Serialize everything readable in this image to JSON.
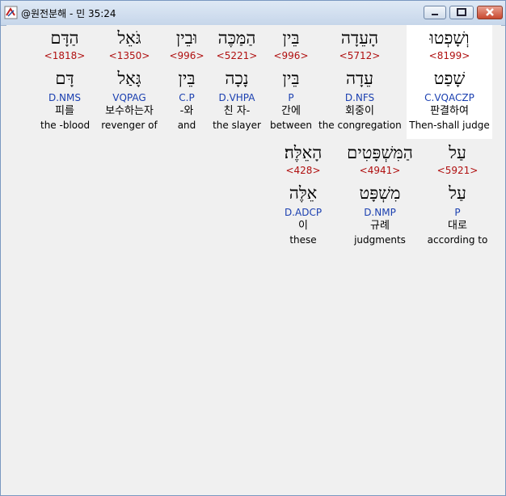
{
  "window": {
    "title": "@원전분해 - 민 35:24",
    "controls": {
      "minimize": "minimize-icon",
      "maximize": "maximize-icon",
      "close": "close-icon"
    }
  },
  "verse": {
    "line1": [
      {
        "hebrew": "הַדָּם",
        "strong": "<1818>",
        "lemma": "דָּם",
        "morph": "D.NMS",
        "korean": "피를",
        "english": "the -blood"
      },
      {
        "hebrew": "גֹּאֵל",
        "strong": "<1350>",
        "lemma": "גָּאַל",
        "morph": "VQPAG",
        "korean": "보수하는자",
        "english": "revenger of"
      },
      {
        "hebrew": "וּבֵין",
        "strong": "<996>",
        "lemma": "בֵּין",
        "morph": "C.P",
        "korean": "-와",
        "english": "and"
      },
      {
        "hebrew": "הַמַּכֶּה",
        "strong": "<5221>",
        "lemma": "נָכָה",
        "morph": "D.VHPA",
        "korean": "친 자-",
        "english": "the slayer"
      },
      {
        "hebrew": "בֵּין",
        "strong": "<996>",
        "lemma": "בֵּין",
        "morph": "P",
        "korean": "간에",
        "english": "between"
      },
      {
        "hebrew": "הָעֵדָה",
        "strong": "<5712>",
        "lemma": "עֵדָה",
        "morph": "D.NFS",
        "korean": "회중이",
        "english": "the congregation"
      },
      {
        "hebrew": "וְשָׁפְטוּ",
        "strong": "<8199>",
        "lemma": "שָׁפַט",
        "morph": "C.VQACZP",
        "korean": "판결하여",
        "english": "Then-shall judge"
      }
    ],
    "line2": [
      {
        "hebrew": "הָאֵלֶּה׃",
        "strong": "<428>",
        "lemma": "אֵלֶּה",
        "morph": "D.ADCP",
        "korean": "이",
        "english": "these"
      },
      {
        "hebrew": "הַמִּשְׁפָּטִים",
        "strong": "<4941>",
        "lemma": "מִשְׁפָּט",
        "morph": "D.NMP",
        "korean": "규례",
        "english": "judgments"
      },
      {
        "hebrew": "עַל",
        "strong": "<5921>",
        "lemma": "עַל",
        "morph": "P",
        "korean": "대로",
        "english": "according to"
      }
    ]
  },
  "colors": {
    "strong": "#b01010",
    "morph": "#1a3fb0",
    "selected": "#ffffff"
  }
}
